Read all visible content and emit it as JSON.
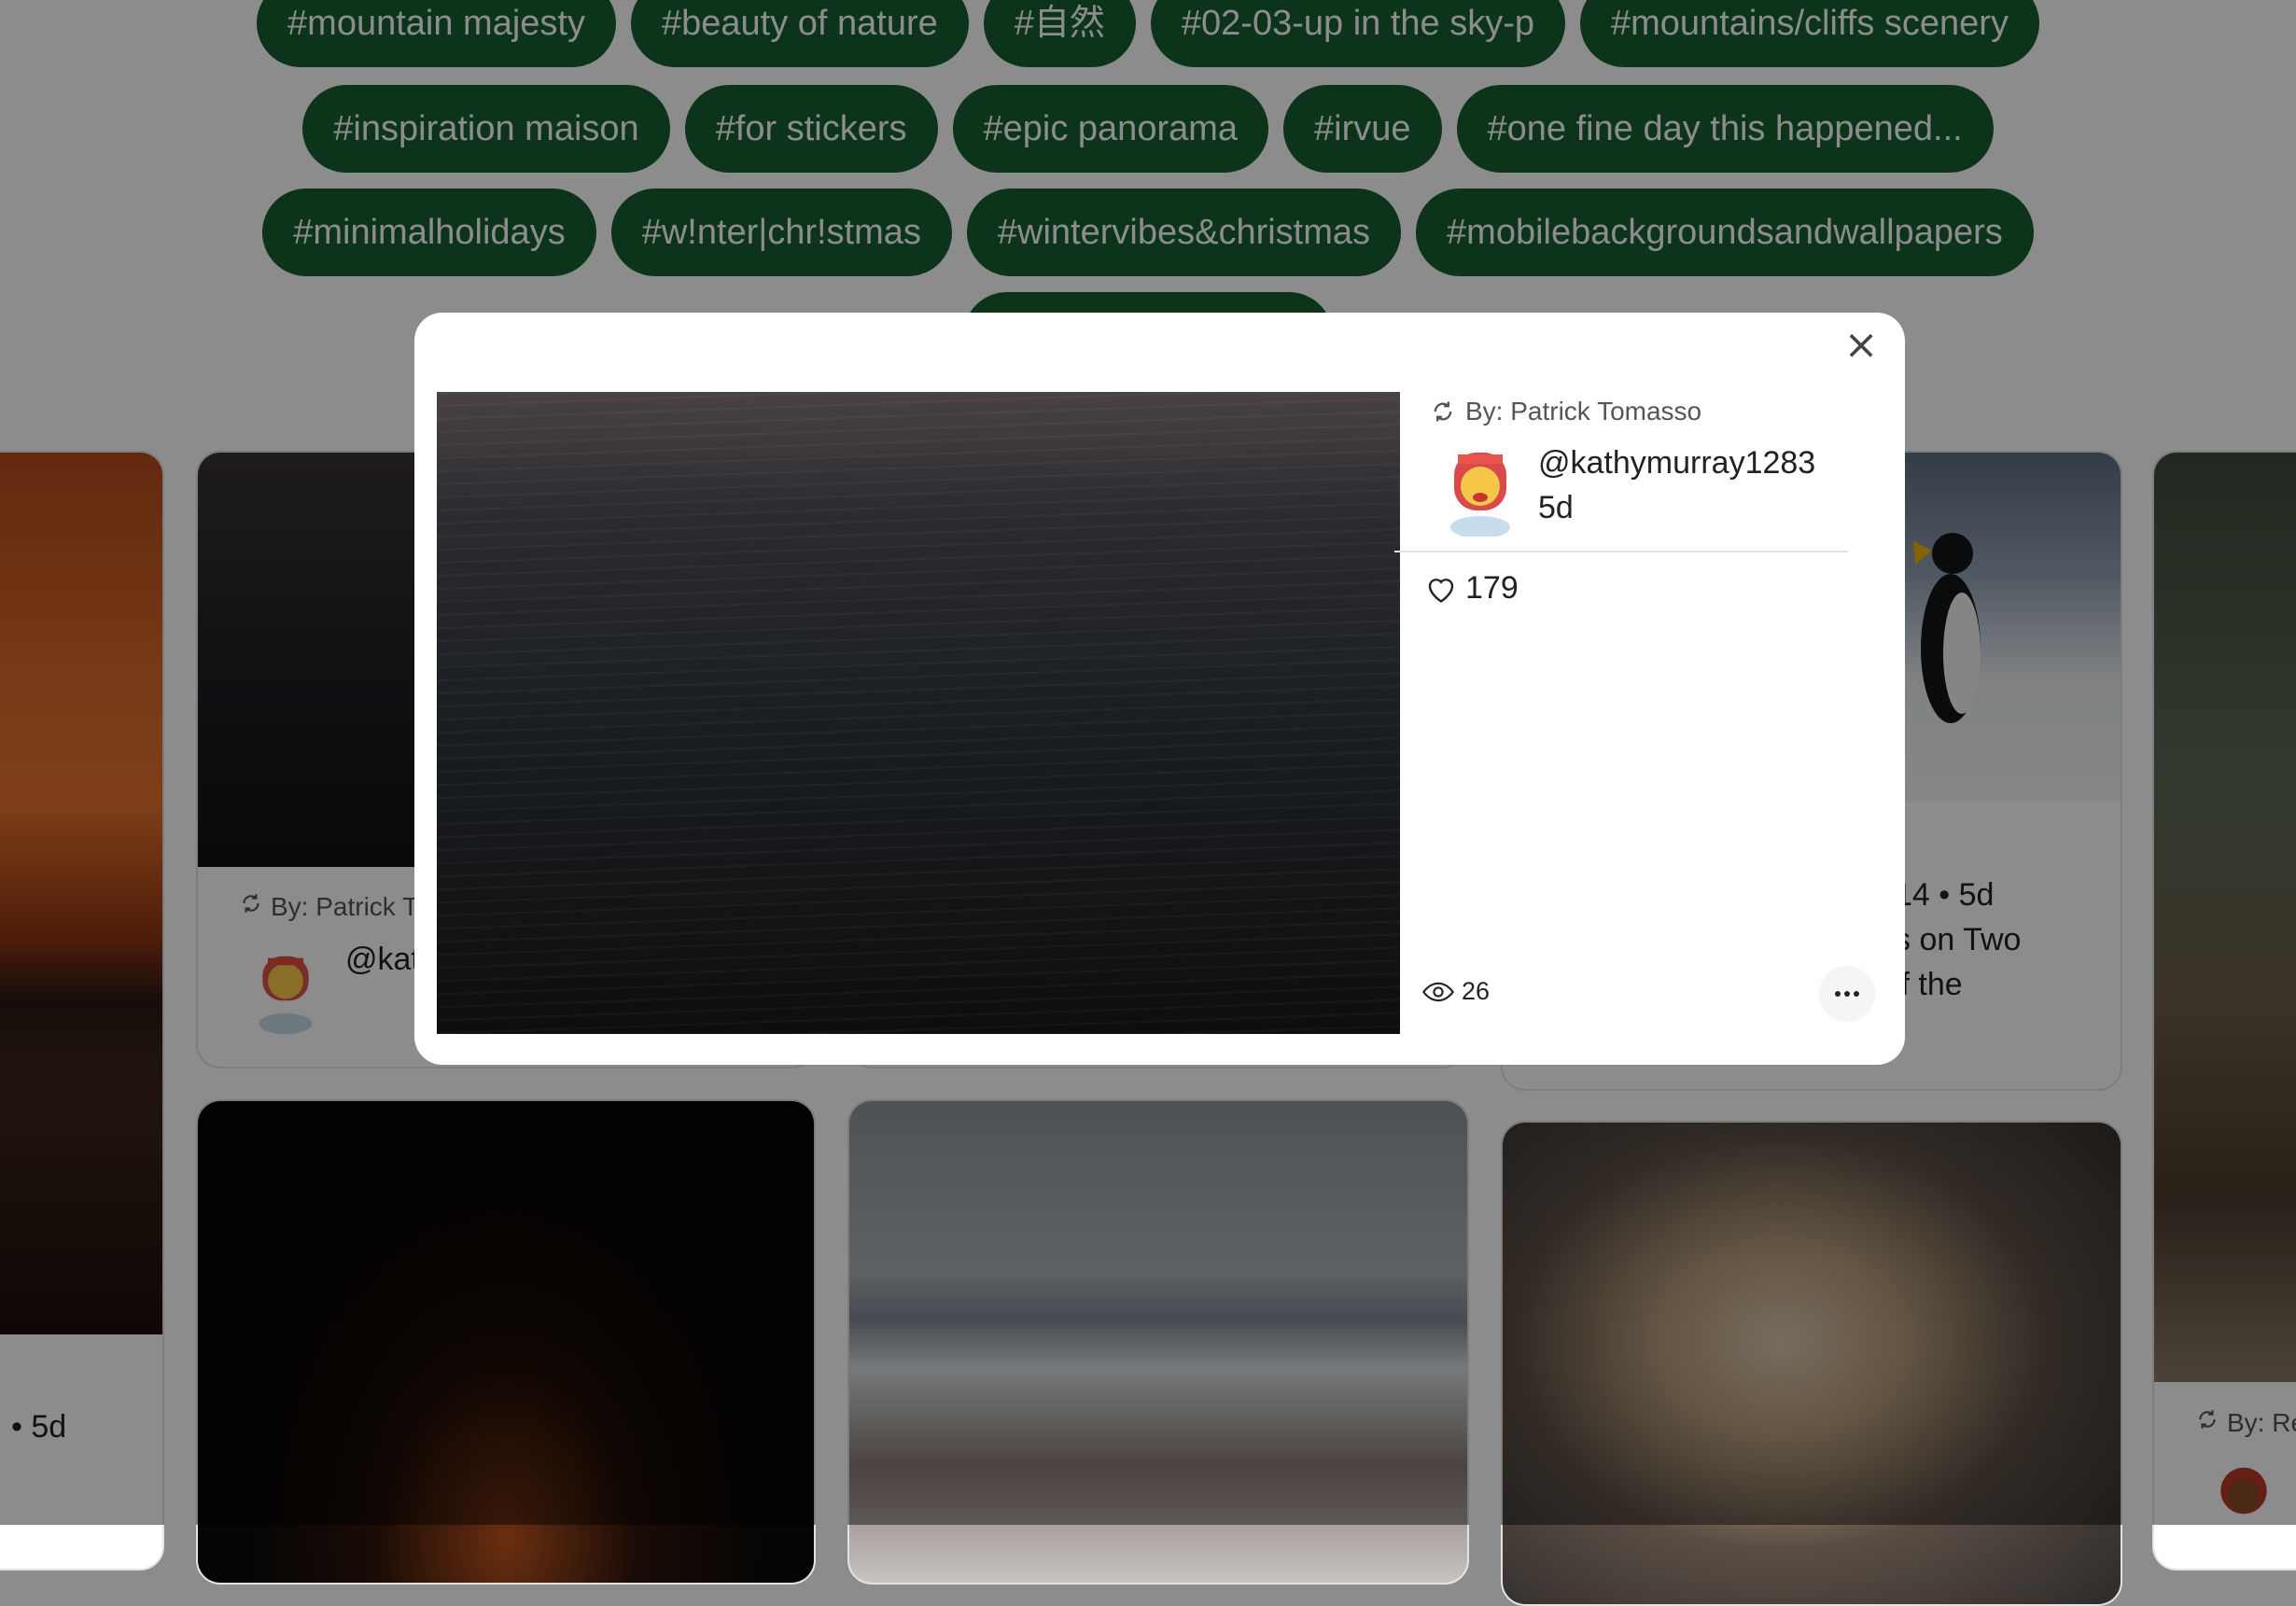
{
  "tags": {
    "row1": [
      "#mountain majesty",
      "#beauty of nature",
      "#自然",
      "#02-03-up in the sky-p",
      "#mountains/cliffs scenery"
    ],
    "row2": [
      "#inspiration maison",
      "#for stickers",
      "#epic panorama",
      "#irvue",
      "#one fine day this happened..."
    ],
    "row3": [
      "#minimalholidays",
      "#w!nter|chr!stmas",
      "#wintervibes&christmas",
      "#mobilebackgroundsandwallpapers"
    ]
  },
  "background_cards": {
    "left_edge": {
      "age_text": "• 5d"
    },
    "card1": {
      "by_label": "By: Patrick To",
      "handle": "@kat"
    },
    "card3": {
      "line1": "14 • 5d",
      "line2": "s on Two",
      "line3": "'f the"
    },
    "right_edge": {
      "by_label": "By: Re"
    }
  },
  "modal": {
    "close_label": "×",
    "by_label": "By: Patrick Tomasso",
    "user": {
      "handle": "@kathymurray1283",
      "age": "5d"
    },
    "likes": "179",
    "views": "26",
    "more_label": "•••",
    "icons": {
      "close": "close-icon",
      "repost": "repost-icon",
      "heart": "heart-icon",
      "eye": "eye-icon",
      "more": "more-icon"
    }
  },
  "colors": {
    "tag_bg": "#175f30",
    "tag_text": "#ffffff",
    "overlay": "rgba(0,0,0,0.45)",
    "modal_bg": "#ffffff"
  }
}
